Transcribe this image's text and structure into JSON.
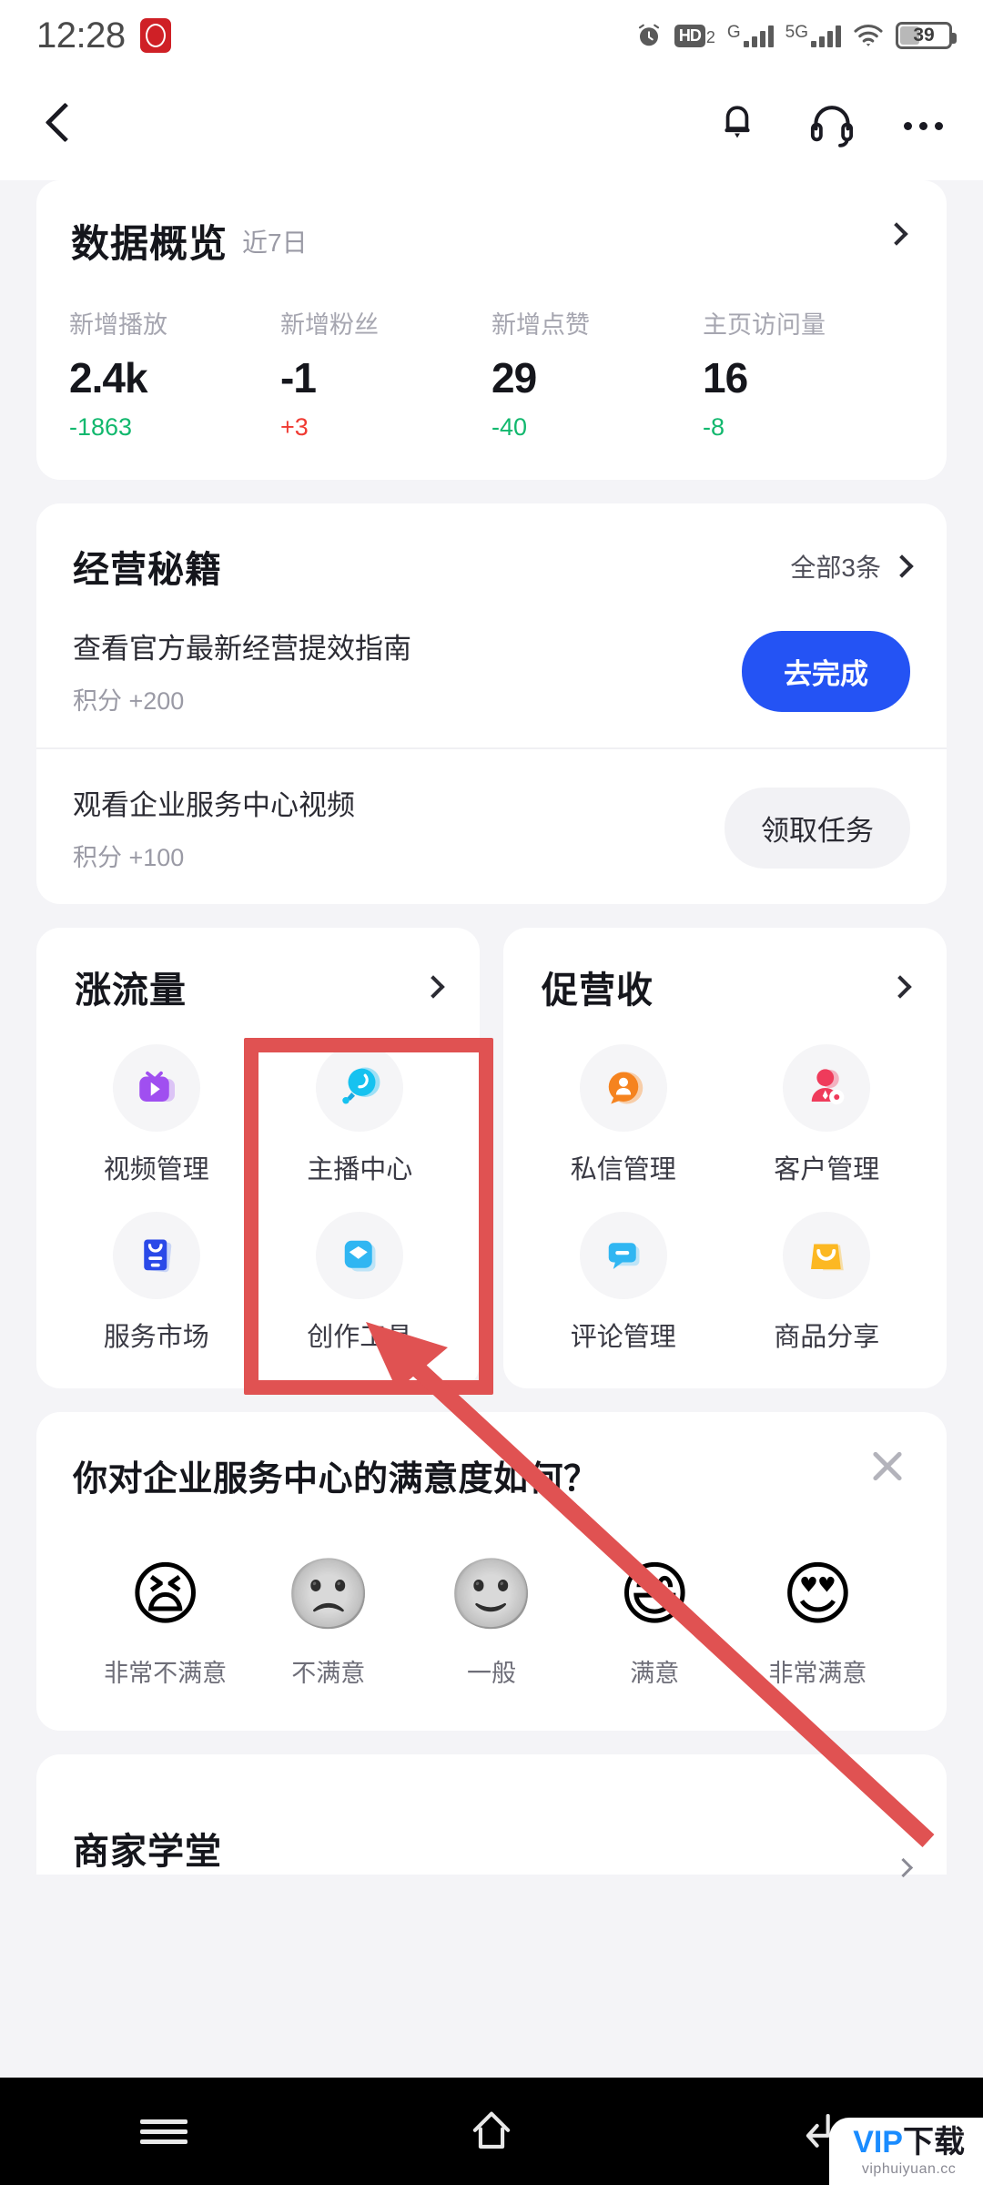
{
  "status_bar": {
    "time": "12:28",
    "app_icon": "cctv-icon",
    "icons": [
      "alarm-icon",
      "hd-icon",
      "signal-g-icon",
      "signal-5g-icon",
      "wifi-icon",
      "battery-icon"
    ],
    "hd_label": "HD",
    "hd_sub": "2",
    "net_g": "G",
    "net_5g": "5G",
    "battery_level": "39"
  },
  "header": {
    "back": "back-chevron",
    "bell": "bell-icon",
    "support": "headset-icon",
    "more": "more-dots-icon"
  },
  "overview": {
    "title": "数据概览",
    "subtitle": "近7日",
    "metrics": [
      {
        "label": "新增播放",
        "value": "2.4k",
        "delta": "-1863",
        "delta_color": "#12b86e"
      },
      {
        "label": "新增粉丝",
        "value": "-1",
        "delta": "+3",
        "delta_color": "#f03a32"
      },
      {
        "label": "新增点赞",
        "value": "29",
        "delta": "-40",
        "delta_color": "#12b86e"
      },
      {
        "label": "主页访问量",
        "value": "16",
        "delta": "-8",
        "delta_color": "#12b86e"
      }
    ]
  },
  "tips": {
    "title": "经营秘籍",
    "all_link": "全部3条",
    "tasks": [
      {
        "title": "查看官方最新经营提效指南",
        "points": "积分 +200",
        "button": "去完成",
        "button_style": "primary"
      },
      {
        "title": "观看企业服务中心视频",
        "points": "积分 +100",
        "button": "领取任务",
        "button_style": "ghost"
      }
    ]
  },
  "panels": [
    {
      "title": "涨流量",
      "tiles": [
        {
          "label": "视频管理",
          "icon": "video-manage-icon"
        },
        {
          "label": "主播中心",
          "icon": "anchor-center-icon"
        },
        {
          "label": "服务市场",
          "icon": "service-market-icon"
        },
        {
          "label": "创作工具",
          "icon": "creator-tools-icon"
        }
      ]
    },
    {
      "title": "促营收",
      "tiles": [
        {
          "label": "私信管理",
          "icon": "private-message-icon"
        },
        {
          "label": "客户管理",
          "icon": "customer-manage-icon"
        },
        {
          "label": "评论管理",
          "icon": "comment-manage-icon"
        },
        {
          "label": "商品分享",
          "icon": "product-share-icon"
        }
      ]
    }
  ],
  "survey": {
    "question": "你对企业服务中心的满意度如何？",
    "close": "close-icon",
    "options": [
      {
        "label": "非常不满意",
        "emoji": "😫"
      },
      {
        "label": "不满意",
        "emoji": "🙁"
      },
      {
        "label": "一般",
        "emoji": "🙂"
      },
      {
        "label": "满意",
        "emoji": "😄"
      },
      {
        "label": "非常满意",
        "emoji": "😍"
      }
    ]
  },
  "peek_card": {
    "title": "商家学堂"
  },
  "nav_bar": {
    "menu": "menu-icon",
    "home": "home-icon",
    "back": "back-icon"
  },
  "watermark": {
    "vip": "VIP",
    "cn": "下载",
    "site": "viphuiyuan.cc"
  },
  "annotation": {
    "color": "#e05252"
  }
}
